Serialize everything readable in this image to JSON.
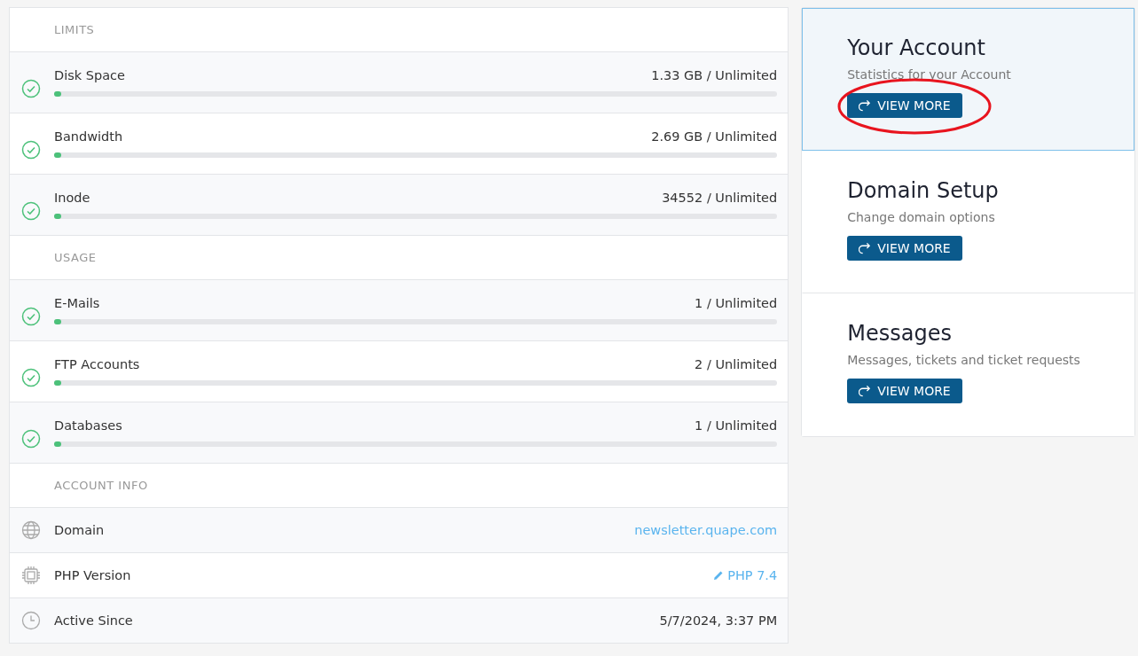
{
  "sections": [
    {
      "title": "LIMITS",
      "items": [
        {
          "kind": "meter",
          "label": "Disk Space",
          "value": "1.33 GB / Unlimited",
          "level": 0.01
        },
        {
          "kind": "meter",
          "label": "Bandwidth",
          "value": "2.69 GB / Unlimited",
          "level": 0.01
        },
        {
          "kind": "meter",
          "label": "Inode",
          "value": "34552 / Unlimited",
          "level": 0.01
        }
      ]
    },
    {
      "title": "USAGE",
      "items": [
        {
          "kind": "meter",
          "label": "E-Mails",
          "value": "1 / Unlimited",
          "level": 0.01
        },
        {
          "kind": "meter",
          "label": "FTP Accounts",
          "value": "2 / Unlimited",
          "level": 0.01
        },
        {
          "kind": "meter",
          "label": "Databases",
          "value": "1 / Unlimited",
          "level": 0.01
        }
      ]
    },
    {
      "title": "ACCOUNT INFO",
      "items": [
        {
          "kind": "link",
          "label": "Domain",
          "value": "newsletter.quape.com"
        },
        {
          "kind": "edit",
          "label": "PHP Version",
          "value": "PHP 7.4"
        },
        {
          "kind": "text",
          "label": "Active Since",
          "value": "5/7/2024, 3:37 PM"
        }
      ]
    }
  ],
  "cards": [
    {
      "title": "Your Account",
      "subtitle": "Statistics for your Account",
      "button": "VIEW MORE",
      "selected": true,
      "circled": true
    },
    {
      "title": "Domain Setup",
      "subtitle": "Change domain options",
      "button": "VIEW MORE",
      "selected": false,
      "circled": false
    },
    {
      "title": "Messages",
      "subtitle": "Messages, tickets and ticket requests",
      "button": "VIEW MORE",
      "selected": false,
      "circled": false
    }
  ]
}
